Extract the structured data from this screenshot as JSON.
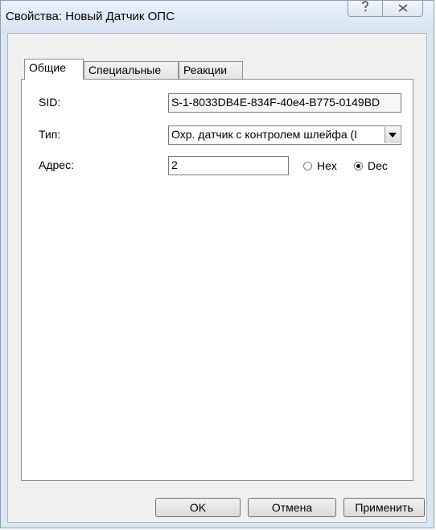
{
  "window": {
    "title": "Свойства: Новый Датчик ОПС",
    "help_icon": "question-mark-icon",
    "close_icon": "close-x-icon"
  },
  "tabs": [
    {
      "label": "Общие",
      "active": true
    },
    {
      "label": "Специальные",
      "active": false
    },
    {
      "label": "Реакции",
      "active": false
    }
  ],
  "general": {
    "sid_label": "SID:",
    "sid_value": "S-1-8033DB4E-834F-40e4-B775-0149BD",
    "type_label": "Тип:",
    "type_value": "Охр. датчик с контролем шлейфа (I",
    "address_label": "Адрес:",
    "address_value": "2",
    "radix_options": [
      {
        "label": "Hex",
        "selected": false
      },
      {
        "label": "Dec",
        "selected": true
      }
    ]
  },
  "buttons": {
    "ok": "OK",
    "cancel": "Отмена",
    "apply": "Применить"
  }
}
